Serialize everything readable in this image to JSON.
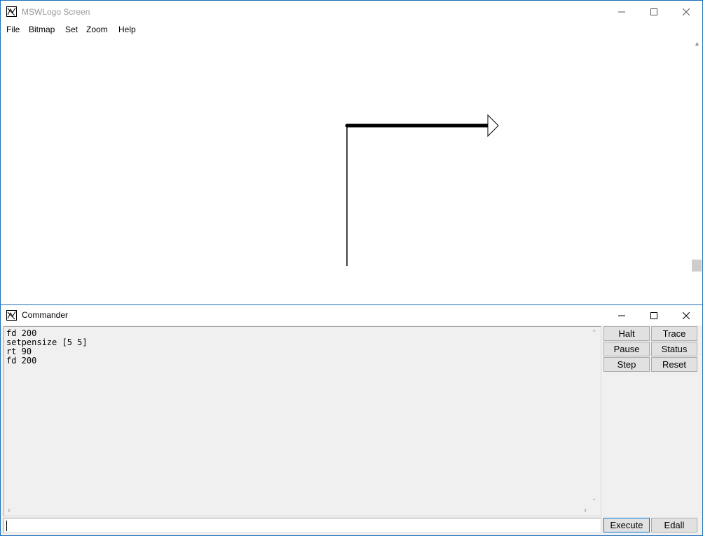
{
  "main_window": {
    "title": "MSWLogo Screen",
    "menu": [
      "File",
      "Bitmap",
      "Set",
      "Zoom",
      "Help"
    ],
    "controls": [
      "minimize-icon",
      "maximize-icon",
      "close-icon"
    ]
  },
  "drawing": {
    "commands_rendered": [
      "fd 200",
      "setpensize [5 5]",
      "rt 90",
      "fd 200"
    ],
    "pen_color": "#000000",
    "turtle_icon": "turtle-triangle-icon"
  },
  "commander": {
    "title": "Commander",
    "history": "fd 200\nsetpensize [5 5]\nrt 90\nfd 200",
    "buttons": {
      "halt": "Halt",
      "trace": "Trace",
      "pause": "Pause",
      "status": "Status",
      "step": "Step",
      "reset": "Reset",
      "execute": "Execute",
      "edall": "Edall"
    },
    "input_value": ""
  },
  "colors": {
    "window_border": "#1e6fb8",
    "panel_bg": "#f0f0f0",
    "button_bg": "#e1e1e1"
  }
}
